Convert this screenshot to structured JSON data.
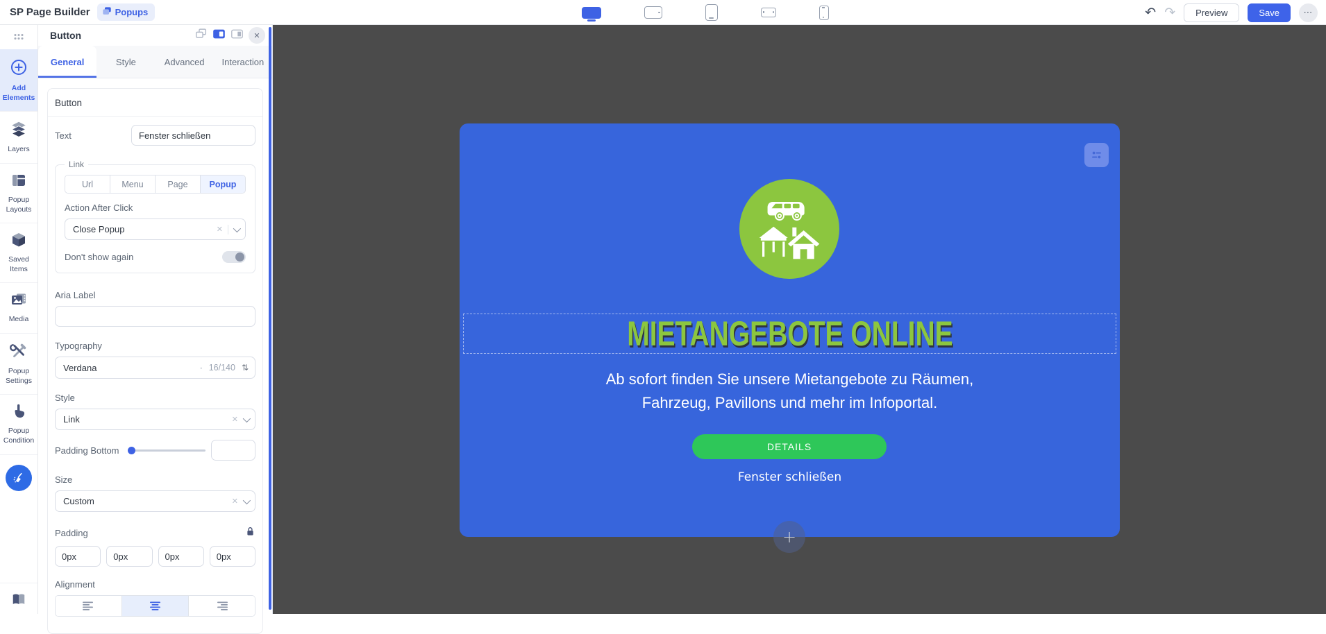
{
  "colors": {
    "accent": "#3E62E4",
    "canvas_bg": "#4B4B4B",
    "popup_blue": "#3765DC",
    "icon_green": "#8CC63F",
    "title_green": "#8CC63F",
    "details_green": "#2EC759"
  },
  "icons": {
    "undo": "↶",
    "redo": "↷",
    "more": "⋯",
    "close": "✕",
    "clear": "✕",
    "updown": "⇅",
    "dot": "·",
    "plus": "+"
  },
  "topbar": {
    "app_title": "SP Page Builder",
    "breadcrumb": "Popups",
    "preview_label": "Preview",
    "save_label": "Save",
    "devices": [
      "desktop",
      "tablet-landscape",
      "tablet-portrait",
      "phone-landscape",
      "phone-portrait"
    ],
    "active_device": "desktop"
  },
  "sidebar": {
    "items": [
      {
        "label": "Add Elements",
        "active": true
      },
      {
        "label": "Layers"
      },
      {
        "label": "Popup Layouts"
      },
      {
        "label": "Saved Items"
      },
      {
        "label": "Media"
      },
      {
        "label": "Popup Settings"
      },
      {
        "label": "Popup Condition"
      }
    ]
  },
  "panel": {
    "title": "Button",
    "tabs": [
      {
        "label": "General",
        "active": true
      },
      {
        "label": "Style"
      },
      {
        "label": "Advanced"
      },
      {
        "label": "Interaction"
      }
    ],
    "section_title": "Button",
    "fields": {
      "text": {
        "label": "Text",
        "value": "Fenster schließen"
      },
      "link": {
        "legend": "Link",
        "options": [
          "Url",
          "Menu",
          "Page",
          "Popup"
        ],
        "selected": "Popup",
        "action_label": "Action After Click",
        "action_value": "Close Popup",
        "dont_show_label": "Don't show again",
        "dont_show_on": false
      },
      "aria": {
        "label": "Aria Label",
        "value": ""
      },
      "typography": {
        "label": "Typography",
        "font": "Verdana",
        "size_value": "16/140"
      },
      "style": {
        "label": "Style",
        "value": "Link"
      },
      "padding_bottom": {
        "label": "Padding Bottom"
      },
      "size": {
        "label": "Size",
        "value": "Custom"
      },
      "padding": {
        "label": "Padding",
        "values": [
          "0px",
          "0px",
          "0px",
          "0px"
        ],
        "locked": true
      },
      "alignment": {
        "label": "Alignment",
        "options": [
          "left",
          "center",
          "right"
        ],
        "selected": "center"
      }
    }
  },
  "popup": {
    "title": "MIETANGEBOTE ONLINE",
    "body_line1": "Ab sofort finden Sie unsere Mietangebote zu Räumen,",
    "body_line2": "Fahrzeug, Pavillons und mehr im Infoportal.",
    "details_label": "DETAILS",
    "close_label": "Fenster schließen"
  }
}
